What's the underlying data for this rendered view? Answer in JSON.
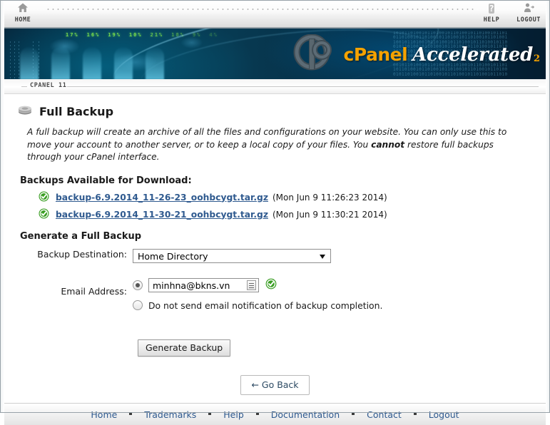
{
  "toolbar": {
    "home_label": "HOME",
    "help_label": "HELP",
    "logout_label": "LOGOUT",
    "help_glyph": "?"
  },
  "banner": {
    "logo_cpanel": "cPanel",
    "logo_accelerated": "Accelerated",
    "logo_version": "2",
    "numbers": [
      "17%",
      "16%",
      "19%",
      "10%",
      "21%",
      "18%",
      "9%",
      "4%"
    ],
    "binary_text": "1010110100101101001011010010110100101101\n0110100101101001011010010110100101101001\n1001011010010110100101101001011010010110\n0101101001011010010110100101101001011010\n1010010110100101101001011010010110100101\n0110100101101001011010010110100101101001\n1101001011010010110100101101001011010010\n0010110100101101001011010010110100101101\n1011010010110100101101001011010010110100\n0101101001011010010110100101101001011010"
  },
  "breadcrumb": {
    "text": "CPANEL 11"
  },
  "page": {
    "title": "Full Backup",
    "intro_part1": "A full backup will create an archive of all the files and configurations on your website. You can only use this to move your account to another server, or to keep a local copy of your files. You ",
    "intro_bold": "cannot",
    "intro_part2": " restore full backups through your cPanel interface."
  },
  "backups_section": {
    "heading": "Backups Available for Download:",
    "items": [
      {
        "filename": "backup-6.9.2014_11-26-23_oohbcygt.tar.gz",
        "date": "(Mon Jun 9 11:26:23 2014)"
      },
      {
        "filename": "backup-6.9.2014_11-30-21_oohbcygt.tar.gz",
        "date": "(Mon Jun 9 11:30:21 2014)"
      }
    ]
  },
  "generate_section": {
    "heading": "Generate a Full Backup",
    "destination_label": "Backup Destination:",
    "destination_value": "Home Directory",
    "destination_options": [
      "Home Directory"
    ],
    "email_label": "Email Address:",
    "email_value": "minhna@bkns.vn",
    "email_radio_selected": true,
    "no_email_label": "Do not send email notification of backup completion.",
    "no_email_radio_selected": false,
    "generate_button": "Generate Backup",
    "go_back_button": "← Go Back"
  },
  "footer": {
    "links": [
      "Home",
      "Trademarks",
      "Help",
      "Documentation",
      "Contact",
      "Logout"
    ]
  },
  "colors": {
    "link": "#2f5a8f",
    "logo_orange": "#f5a200",
    "check_green": "#3a9e23",
    "banner_dark": "#052338"
  }
}
